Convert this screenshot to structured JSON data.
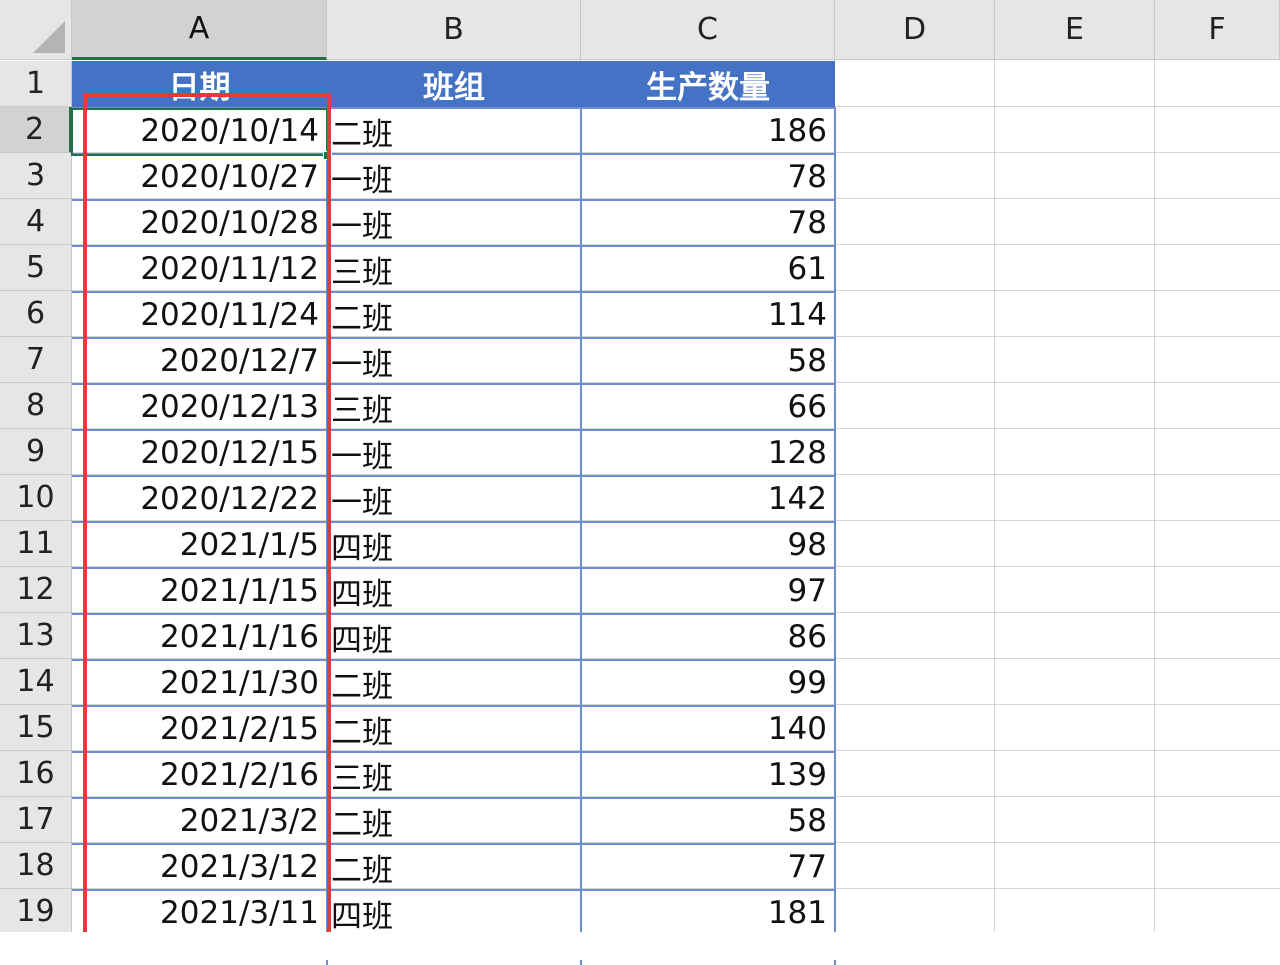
{
  "columns": [
    "A",
    "B",
    "C",
    "D",
    "E",
    "F"
  ],
  "row_numbers": [
    "1",
    "2",
    "3",
    "4",
    "5",
    "6",
    "7",
    "8",
    "9",
    "10",
    "11",
    "12",
    "13",
    "14",
    "15",
    "16",
    "17",
    "18",
    "19"
  ],
  "table": {
    "headers": [
      "日期",
      "班组",
      "生产数量"
    ],
    "rows": [
      [
        "2020/10/14",
        "二班",
        "186"
      ],
      [
        "2020/10/27",
        "一班",
        "78"
      ],
      [
        "2020/10/28",
        "一班",
        "78"
      ],
      [
        "2020/11/12",
        "三班",
        "61"
      ],
      [
        "2020/11/24",
        "二班",
        "114"
      ],
      [
        "2020/12/7",
        "一班",
        "58"
      ],
      [
        "2020/12/13",
        "三班",
        "66"
      ],
      [
        "2020/12/15",
        "一班",
        "128"
      ],
      [
        "2020/12/22",
        "一班",
        "142"
      ],
      [
        "2021/1/5",
        "四班",
        "98"
      ],
      [
        "2021/1/15",
        "四班",
        "97"
      ],
      [
        "2021/1/16",
        "四班",
        "86"
      ],
      [
        "2021/1/30",
        "二班",
        "99"
      ],
      [
        "2021/2/15",
        "二班",
        "140"
      ],
      [
        "2021/2/16",
        "三班",
        "139"
      ],
      [
        "2021/3/2",
        "二班",
        "58"
      ],
      [
        "2021/3/12",
        "二班",
        "77"
      ],
      [
        "2021/3/11",
        "四班",
        "181"
      ]
    ]
  },
  "selection": {
    "active_cell": "A2",
    "active_column": "A",
    "active_row": "2"
  },
  "highlight": {
    "color": "#e33b3b",
    "range": "A2:A19"
  },
  "colors": {
    "table_header_bg": "#4472c4",
    "table_header_text": "#ffffff",
    "selection_accent": "#217346"
  }
}
